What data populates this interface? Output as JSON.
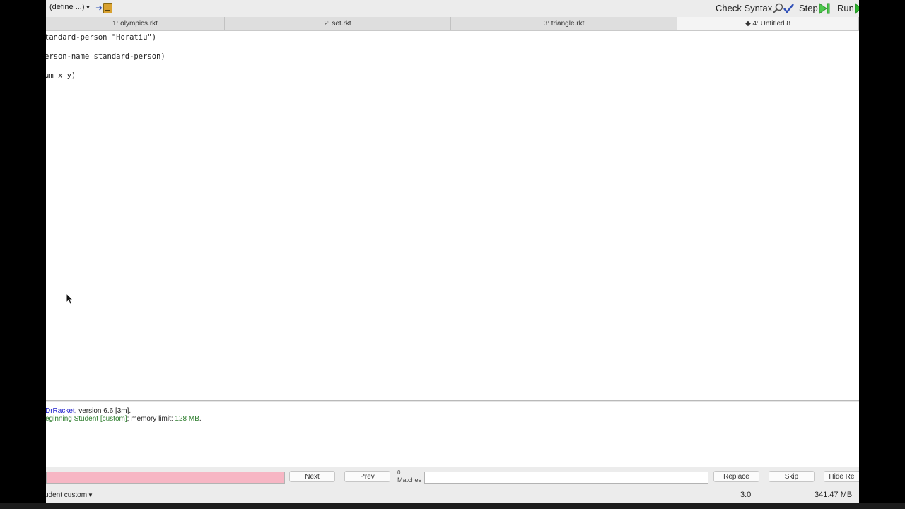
{
  "toolbar": {
    "define_menu": "(define ...)",
    "check_syntax": "Check Syntax",
    "step": "Step",
    "run": "Run"
  },
  "tabs": [
    {
      "label": "1: olympics.rkt",
      "active": false
    },
    {
      "label": "2: set.rkt",
      "active": false
    },
    {
      "label": "3: triangle.rkt",
      "active": false
    },
    {
      "label": "◆ 4: Untitled 8",
      "active": true
    }
  ],
  "editor": {
    "lines": [
      "tandard-person \"Horatiu\")",
      "erson-name standard-person)",
      "um x y)"
    ]
  },
  "interactions": {
    "link_text": "DrRacket",
    "version_text": ", version 6.6 [3m].",
    "language_text": "eginning Student [custom]",
    "memory_prefix": "; memory limit: ",
    "memory_value": "128 MB",
    "period": "."
  },
  "searchbar": {
    "next": "Next",
    "prev": "Prev",
    "matches_count": "0",
    "matches_label": "Matches",
    "replace": "Replace",
    "skip": "Skip",
    "hide": "Hide Re"
  },
  "statusbar": {
    "language": "udent custom",
    "position": "3:0",
    "memory": "341.47 MB"
  },
  "colors": {
    "find_field": "#f7b6c4",
    "link": "#2222cc",
    "green_text": "#2d7d2d",
    "run_arrow": "#2fb52f"
  }
}
